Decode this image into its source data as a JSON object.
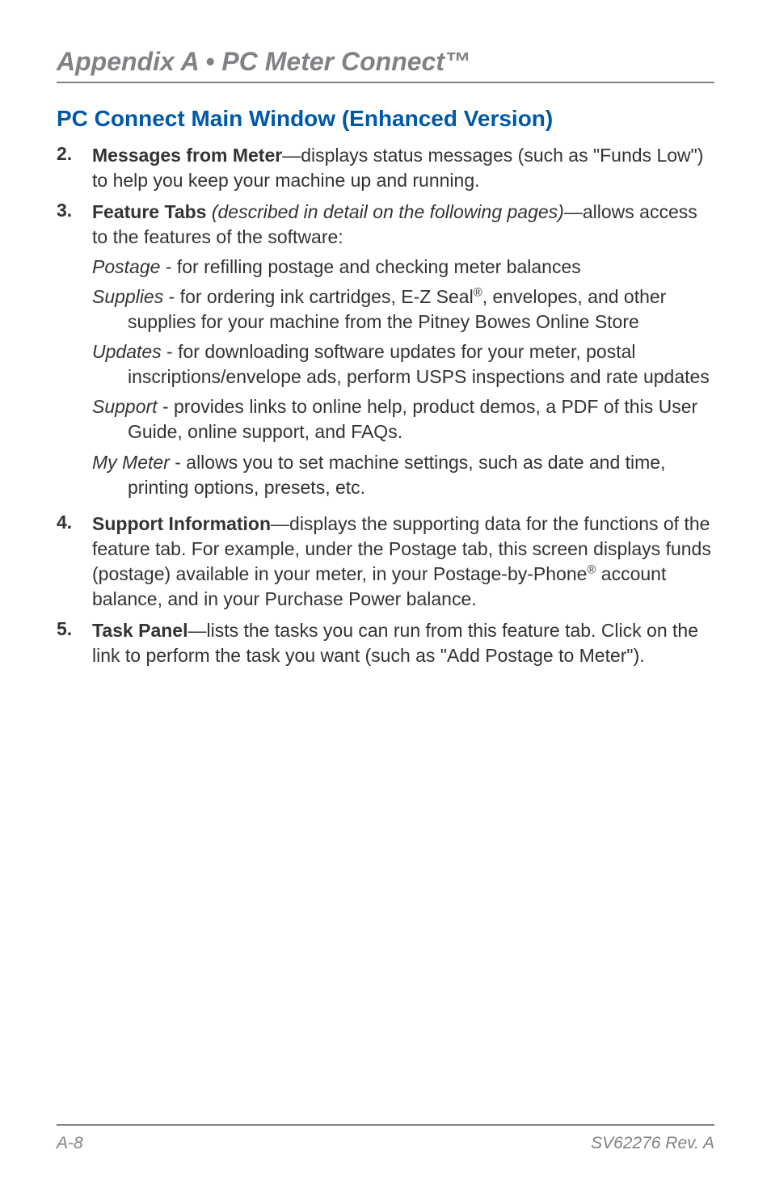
{
  "header": {
    "title": "Appendix A • PC Meter Connect™"
  },
  "section_title": "PC Connect Main Window (Enhanced Version)",
  "items": [
    {
      "num": "2.",
      "bold": "Messages from Meter",
      "rest": "—displays status messages (such as \"Funds Low\") to help you keep your machine up and running."
    },
    {
      "num": "3.",
      "bold": "Feature Tabs",
      "italic": " (described in detail on the following pages)",
      "rest": "—allows access to the features of the software:",
      "subs": [
        {
          "term": "Postage",
          "desc": " - for refilling postage and checking meter balances"
        },
        {
          "term": "Supplies",
          "desc_before_sup": " - for ordering ink cartridges, E-Z Seal",
          "sup": "®",
          "desc_after_sup": ", envelopes, and other supplies for your machine from the Pitney Bowes Online Store"
        },
        {
          "term": "Updates",
          "desc": " - for downloading software updates for your meter, postal inscriptions/envelope ads, perform USPS inspections and rate updates"
        },
        {
          "term": "Support",
          "desc": " - provides links to online help, product demos, a PDF of this User Guide, online support, and FAQs."
        },
        {
          "term": "My Meter",
          "desc": " - allows you to set machine settings, such as date and time, printing options, presets, etc."
        }
      ]
    },
    {
      "num": "4.",
      "bold": "Support Information",
      "rest_before_sup": "—displays the supporting data for the functions of the feature tab. For example, under the Postage tab, this screen displays funds (postage) available in your meter, in your Postage-by-Phone",
      "sup": "®",
      "rest_after_sup": " account balance, and in your Purchase Power balance."
    },
    {
      "num": "5.",
      "bold": "Task Panel",
      "rest": "—lists the tasks you can run from this feature tab. Click on the link to perform the task you want (such as \"Add Postage to Meter\")."
    }
  ],
  "footer": {
    "left": "A-8",
    "right": "SV62276 Rev. A"
  }
}
